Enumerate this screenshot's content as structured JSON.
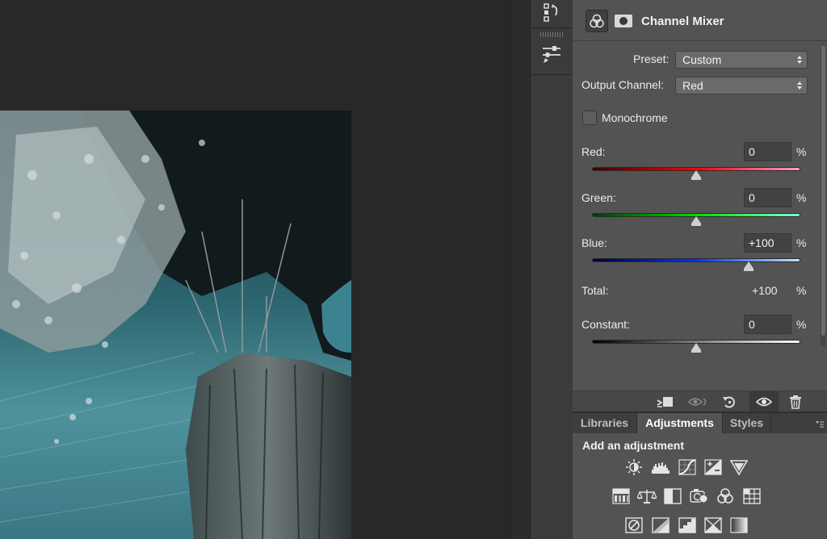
{
  "properties": {
    "title": "Channel Mixer",
    "preset_label": "Preset:",
    "preset_value": "Custom",
    "output_channel_label": "Output Channel:",
    "output_channel_value": "Red",
    "monochrome_label": "Monochrome",
    "monochrome_checked": false,
    "percent_symbol": "%",
    "sources": [
      {
        "label": "Red:",
        "value": "0",
        "percent": 0
      },
      {
        "label": "Green:",
        "value": "0",
        "percent": 0
      },
      {
        "label": "Blue:",
        "value": "+100",
        "percent": 100
      }
    ],
    "total_label": "Total:",
    "total_value": "+100",
    "constant_label": "Constant:",
    "constant_value": "0",
    "constant_percent": 0,
    "slider_colors": {
      "red": [
        "#3c0000",
        "#ff0000",
        "#ff9bd0"
      ],
      "green": [
        "#003c00",
        "#00dd00",
        "#7fffd0"
      ],
      "blue": [
        "#00003c",
        "#0033ff",
        "#bfe3ff"
      ],
      "constant": [
        "#000000",
        "#7f7f7f",
        "#ffffff"
      ]
    }
  },
  "footer_icons": [
    "clip-to-layer-icon",
    "view-previous-state-icon",
    "reset-icon",
    "visibility-eye-icon",
    "trash-icon"
  ],
  "adjustments_panel": {
    "tabs": [
      "Libraries",
      "Adjustments",
      "Styles"
    ],
    "active_tab": "Adjustments",
    "heading": "Add an adjustment",
    "row1_icons": [
      "brightness-contrast-icon",
      "levels-icon",
      "curves-icon",
      "exposure-icon",
      "vibrance-icon"
    ],
    "row2_icons": [
      "hue-saturation-icon",
      "color-balance-icon",
      "black-white-icon",
      "photo-filter-icon",
      "channel-mixer-icon",
      "color-lookup-icon"
    ],
    "row3_icons": [
      "invert-icon",
      "posterize-icon",
      "threshold-icon",
      "selective-color-icon",
      "gradient-map-icon"
    ]
  }
}
